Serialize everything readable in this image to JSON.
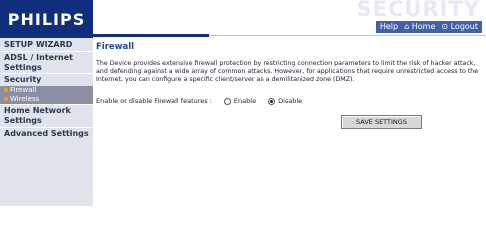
{
  "brand": {
    "logo": "PHILIPS",
    "section_title": "SECURITY"
  },
  "toplinks": {
    "help": "Help",
    "home": "Home",
    "logout": "Logout"
  },
  "sidebar": {
    "items": [
      {
        "label": "SETUP WIZARD"
      },
      {
        "label": "ADSL / Internet Settings"
      },
      {
        "label": "Security"
      },
      {
        "label": "Firewall"
      },
      {
        "label": "Wireless"
      },
      {
        "label": "Home Network Settings"
      },
      {
        "label": "Advanced Settings"
      }
    ]
  },
  "main": {
    "title": "Firewall",
    "description": "The Device provides extensive firewall protection by restricting connection parameters to limit the risk of hacker attack, and defending against a wide array of common attacks. However, for applications that require unrestricted access to the Internet, you can configure a specific client/server as a demilitanized zone (DMZ).",
    "firewall_label": "Enable or disable Firewall features :",
    "option_enable": "Enable",
    "option_disable": "Disable",
    "selected": "Disable",
    "save_label": "SAVE SETTINGS"
  },
  "colors": {
    "brand_blue": "#0f2f7c",
    "sidebar_bg": "#dfe3ea",
    "sub_active_bg": "#8a8fa3",
    "bullet": "#f39a1b",
    "title": "#1a4aa0"
  }
}
